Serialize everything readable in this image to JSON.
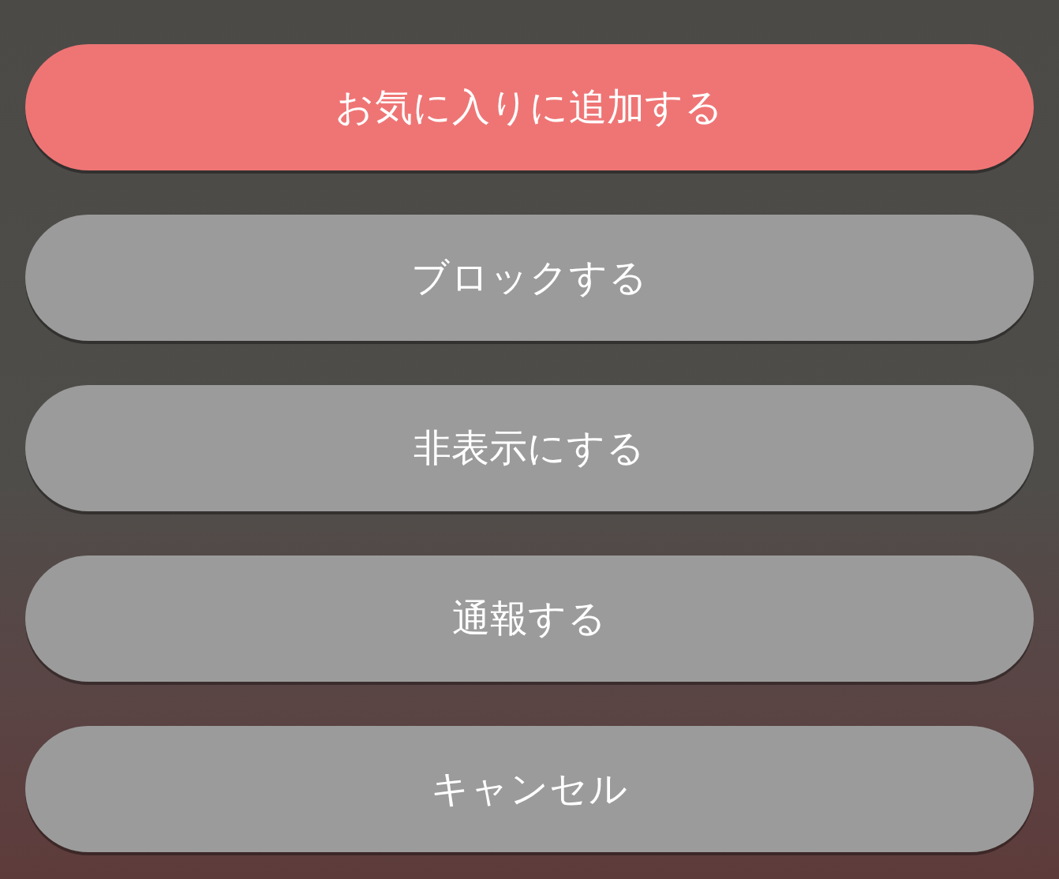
{
  "actions": [
    {
      "label": "お気に入りに追加する",
      "kind": "primary"
    },
    {
      "label": "ブロックする",
      "kind": "default"
    },
    {
      "label": "非表示にする",
      "kind": "default"
    },
    {
      "label": "通報する",
      "kind": "default"
    },
    {
      "label": "キャンセル",
      "kind": "default"
    }
  ]
}
